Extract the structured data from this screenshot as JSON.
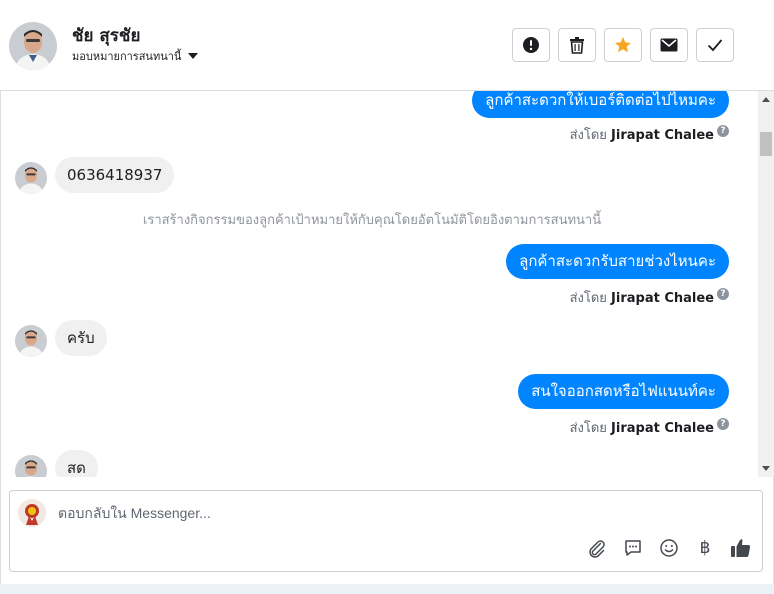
{
  "header": {
    "contact_name": "ชัย สุรชัย",
    "assign_label": "มอบหมายการสนทนานี้",
    "actions": [
      {
        "name": "mark-spam",
        "icon": "exclamation-circle-icon"
      },
      {
        "name": "delete",
        "icon": "trash-icon"
      },
      {
        "name": "star",
        "icon": "star-icon",
        "color": "#f5a623"
      },
      {
        "name": "mark-unread",
        "icon": "envelope-icon"
      },
      {
        "name": "mark-done",
        "icon": "checkmark-icon"
      }
    ]
  },
  "thread": {
    "sent_by_prefix": "ส่งโดย",
    "agent_name": "Jirapat Chalee",
    "messages": [
      {
        "dir": "out",
        "text": "ลูกค้าสะดวกให้เบอร์ติดต่อไปไหมคะ"
      },
      {
        "dir": "in",
        "text": "0636418937"
      },
      {
        "dir": "system",
        "text": "เราสร้างกิจกรรมของลูกค้าเป้าหมายให้กับคุณโดยอัตโนมัติโดยอิงตามการสนทนานี้"
      },
      {
        "dir": "out",
        "text": "ลูกค้าสะดวกรับสายช่วงไหนคะ"
      },
      {
        "dir": "in",
        "text": "ครับ"
      },
      {
        "dir": "out",
        "text": "สนใจออกสดหรือไฟแนนท์คะ"
      },
      {
        "dir": "in",
        "text": "สด"
      }
    ]
  },
  "composer": {
    "placeholder": "ตอบกลับใน Messenger...",
    "tools": [
      "paperclip-icon",
      "saved-reply-icon",
      "emoji-icon",
      "baht-icon",
      "thumbs-up-icon"
    ],
    "baht_symbol": "฿"
  },
  "colors": {
    "outgoing_bubble": "#0084ff",
    "incoming_bubble": "#f1f0f0",
    "star": "#f5a623"
  }
}
